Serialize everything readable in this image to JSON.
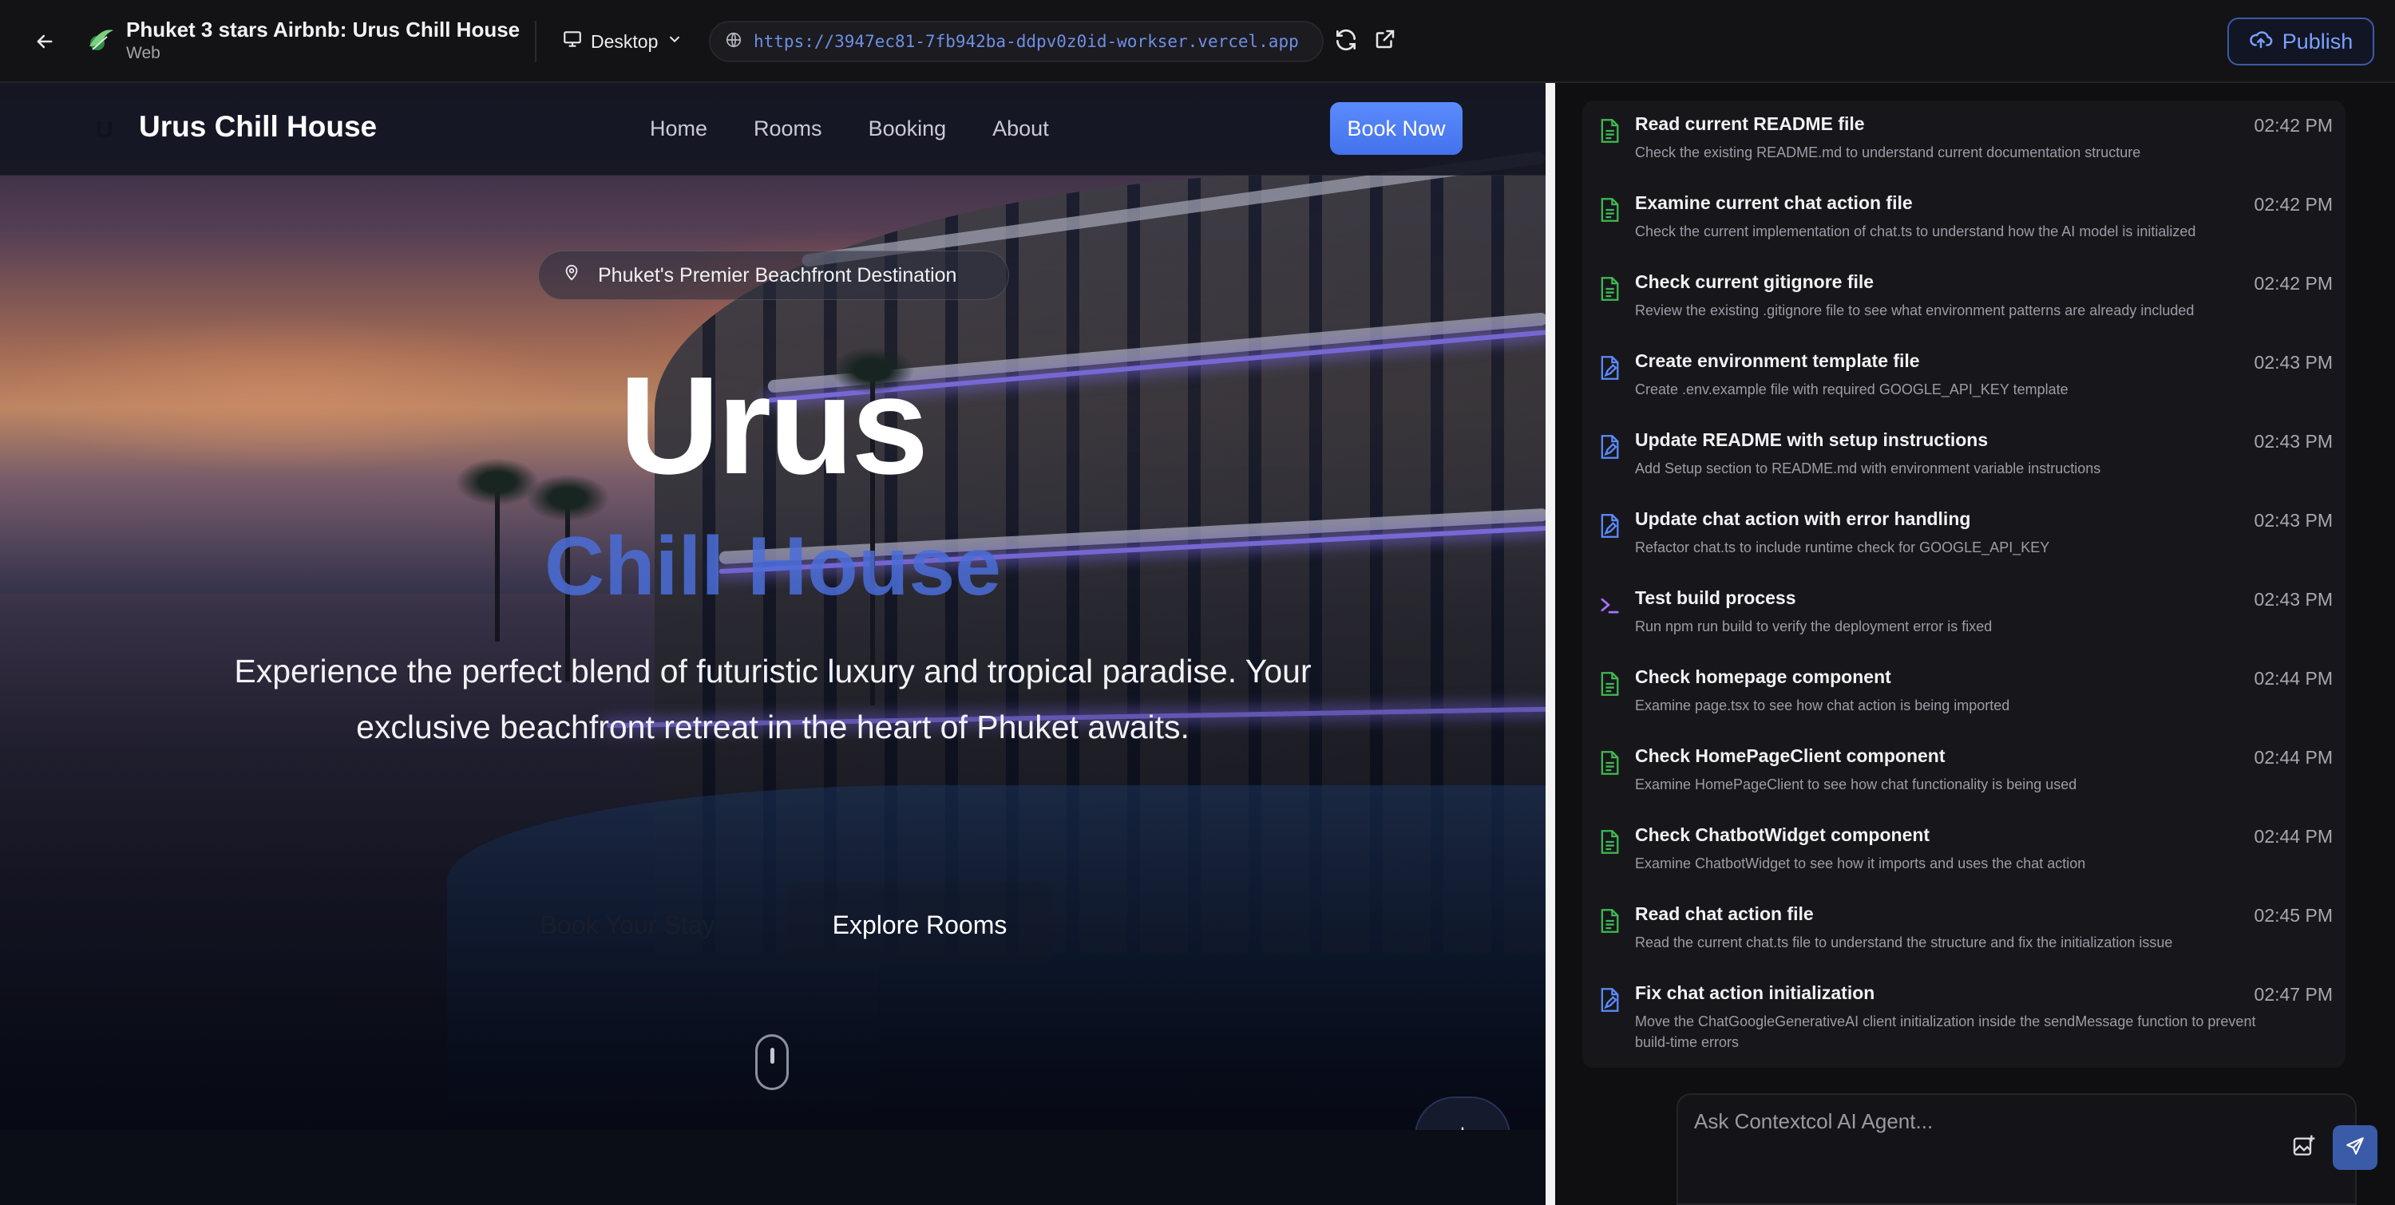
{
  "topbar": {
    "title": "Phuket 3 stars Airbnb: Urus Chill House",
    "subtitle": "Web",
    "device": "Desktop",
    "url": "https://3947ec81-7fb942ba-ddpv0z0id-workser.vercel.app",
    "publish": "Publish"
  },
  "site": {
    "logo_mark": "U",
    "logo": "Urus Chill House",
    "nav": [
      "Home",
      "Rooms",
      "Booking",
      "About"
    ],
    "book_now": "Book Now",
    "badge": "Phuket's Premier Beachfront Destination",
    "headline": "Urus",
    "subheadline": "Chill House",
    "description": "Experience the perfect blend of futuristic luxury and tropical paradise. Your exclusive beachfront retreat in the heart of Phuket awaits.",
    "btn_stay": "Book Your Stay",
    "btn_explore": "Explore Rooms"
  },
  "tasks": [
    {
      "icon": "file-check-icon",
      "title": "Read current README file",
      "desc": "Check the existing README.md to understand current documentation structure",
      "time": "02:42 PM"
    },
    {
      "icon": "file-check-icon",
      "title": "Examine current chat action file",
      "desc": "Check the current implementation of chat.ts to understand how the AI model is initialized",
      "time": "02:42 PM"
    },
    {
      "icon": "file-check-icon",
      "title": "Check current gitignore file",
      "desc": "Review the existing .gitignore file to see what environment patterns are already included",
      "time": "02:42 PM"
    },
    {
      "icon": "file-edit-icon",
      "title": "Create environment template file",
      "desc": "Create .env.example file with required GOOGLE_API_KEY template",
      "time": "02:43 PM"
    },
    {
      "icon": "file-edit-icon",
      "title": "Update README with setup instructions",
      "desc": "Add Setup section to README.md with environment variable instructions",
      "time": "02:43 PM"
    },
    {
      "icon": "file-edit-icon",
      "title": "Update chat action with error handling",
      "desc": "Refactor chat.ts to include runtime check for GOOGLE_API_KEY",
      "time": "02:43 PM"
    },
    {
      "icon": "terminal-icon",
      "title": "Test build process",
      "desc": "Run npm run build to verify the deployment error is fixed",
      "time": "02:43 PM"
    },
    {
      "icon": "file-check-icon",
      "title": "Check homepage component",
      "desc": "Examine page.tsx to see how chat action is being imported",
      "time": "02:44 PM"
    },
    {
      "icon": "file-check-icon",
      "title": "Check HomePageClient component",
      "desc": "Examine HomePageClient to see how chat functionality is being used",
      "time": "02:44 PM"
    },
    {
      "icon": "file-check-icon",
      "title": "Check ChatbotWidget component",
      "desc": "Examine ChatbotWidget to see how it imports and uses the chat action",
      "time": "02:44 PM"
    },
    {
      "icon": "file-check-icon",
      "title": "Read chat action file",
      "desc": "Read the current chat.ts file to understand the structure and fix the initialization issue",
      "time": "02:45 PM"
    },
    {
      "icon": "file-edit-icon",
      "title": "Fix chat action initialization",
      "desc": "Move the ChatGoogleGenerativeAI client initialization inside the sendMessage function to prevent build-time errors",
      "time": "02:47 PM"
    }
  ],
  "ask": {
    "placeholder": "Ask Contextcol AI Agent..."
  },
  "colors": {
    "accent": "#4472ea",
    "check": "#3fb950",
    "edit": "#5b8bff",
    "terminal": "#a970ff"
  }
}
